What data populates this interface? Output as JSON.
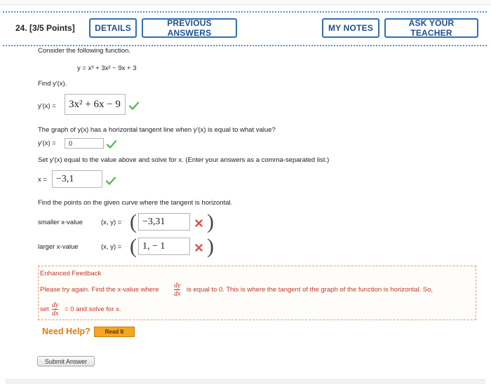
{
  "question": {
    "number": "24.",
    "points": "[3/5 Points]"
  },
  "header_buttons": {
    "details": "DETAILS",
    "previous_answers": "PREVIOUS ANSWERS",
    "my_notes": "MY NOTES",
    "ask_teacher": "ASK YOUR TEACHER"
  },
  "prompt": {
    "intro": "Consider the following function.",
    "function": "y = x³ + 3x² − 9x + 3",
    "find_label": "Find y'(x).",
    "derivative_label": "y'(x) =",
    "derivative_answer": "3x² + 6x − 9",
    "tangent_question": "The graph of y(x) has a horizontal tangent line when y'(x) is equal to what value?",
    "tangent_label": "y'(x) =",
    "tangent_answer": "0",
    "solve_instruction": "Set y'(x) equal to the value above and solve for x. (Enter your answers as a comma-separated list.)",
    "x_label": "x =",
    "x_answer": "−3,1",
    "points_instruction": "Find the points on the given curve where the tangent is horizontal.",
    "smaller_label": "smaller x-value",
    "smaller_xy_label": "(x, y) =",
    "smaller_answer": "−3,31",
    "larger_label": "larger x-value",
    "larger_xy_label": "(x, y) =",
    "larger_answer": "1, − 1"
  },
  "feedback": {
    "title": "Enhanced Feedback",
    "line1_pre": "Please try again. Find the x-value where",
    "line1_post": "is equal to 0. This is where the tangent of the graph of the function is horizontal. So,",
    "line2_pre": "set",
    "line2_post": "= 0 and solve for x.",
    "frac_num": "dy",
    "frac_den": "dx"
  },
  "help": {
    "need_help": "Need Help?",
    "read_it": "Read It"
  },
  "submit": {
    "label": "Submit Answer"
  },
  "colors": {
    "accent_blue": "#2f6fb3",
    "correct_green": "#5cb85c",
    "wrong_red": "#d9534f",
    "feedback_red": "#c0392b",
    "help_orange": "#e07a1a"
  },
  "icons": {
    "correct": "check-icon",
    "incorrect": "x-icon"
  }
}
